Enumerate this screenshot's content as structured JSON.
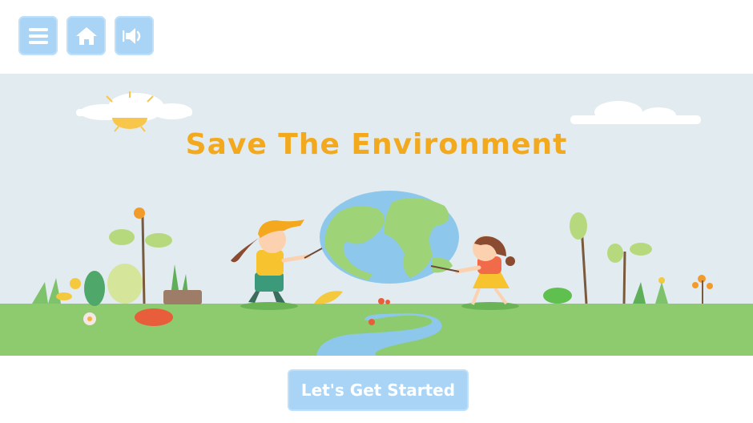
{
  "toolbar": {
    "menu_icon": "menu-icon",
    "home_icon": "home-icon",
    "sound_icon": "speaker-icon"
  },
  "hero": {
    "title": "Save The Environment"
  },
  "start_button": {
    "label": "Let's Get Started"
  },
  "colors": {
    "accent_blue": "#a9d4f5",
    "title_orange": "#f3a91d",
    "sky": "#e2ebf0",
    "grass": "#8ecb6e"
  }
}
